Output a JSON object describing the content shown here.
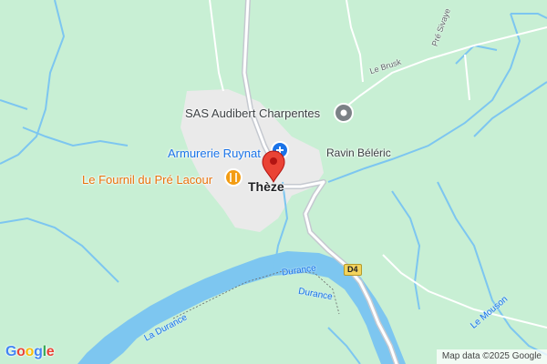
{
  "map": {
    "pois": {
      "audibert": "SAS Audibert Charpentes",
      "armurerie": "Armurerie Ruynat",
      "fournil": "Le Fournil du Pré Lacour"
    },
    "places": {
      "town": "Thèze",
      "ravin": "Ravin Béléric"
    },
    "roads": {
      "le_brusk": "Le Brusk",
      "pre_sivaye": "Pré Sivaye",
      "d4": "D4"
    },
    "water": {
      "durance_1": "Durance",
      "durance_2": "Durance",
      "la_durance": "La Durance",
      "le_mouson": "Le Mouson"
    },
    "footer": {
      "attribution": "Map data ©2025 Google",
      "logo": [
        "G",
        "o",
        "o",
        "g",
        "l",
        "e"
      ]
    },
    "colors": {
      "land": "#c8efd4",
      "urban": "#eaeaea",
      "water": "#7dc6f0",
      "road": "#ffffff",
      "major_road": "#c5c9d0",
      "pin": "#ea4335"
    }
  }
}
